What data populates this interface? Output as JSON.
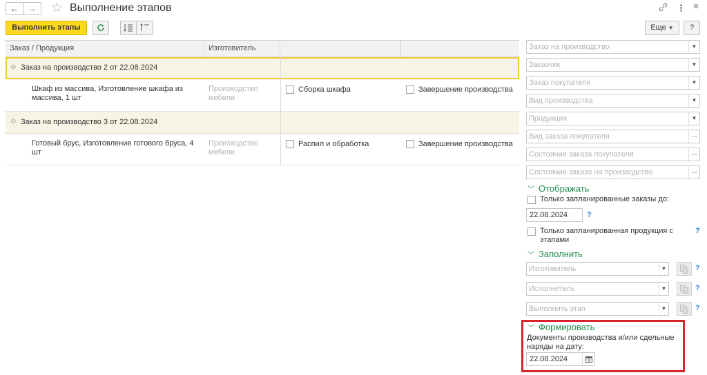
{
  "window": {
    "title": "Выполнение этапов",
    "back_icon": "←",
    "forward_icon": "→",
    "star_icon": "☆",
    "link_icon": "🔗",
    "menu_icon": "⋮",
    "close_icon": "×"
  },
  "toolbar": {
    "run_button": "Выполнить этапы",
    "more_button": "Еще",
    "help_button": "?"
  },
  "table": {
    "columns": [
      "Заказ / Продукция",
      "Изготовитель"
    ],
    "groups": [
      {
        "title": "Заказ на производство 2 от 22.08.2024",
        "product": "Шкаф из массива, Изготовление шкафа из массива, 1 шт",
        "maker": "Производство мебели",
        "stage1": "Сборка шкафа",
        "stage2": "Завершение производства"
      },
      {
        "title": "Заказ на производство 3 от 22.08.2024",
        "product": "Готовый брус, Изготовление готового бруса, 4 шт",
        "maker": "Производство мебели",
        "stage1": "Распил и обработка",
        "stage2": "Завершение производства"
      }
    ]
  },
  "filters": {
    "order": "Заказ на производство",
    "customer": "Заказчик",
    "customer_order": "Заказ покупателя",
    "production_type": "Вид производства",
    "product": "Продукция",
    "customer_order_type": "Вид заказа покупателя",
    "customer_order_state": "Состояние заказа покупателя",
    "production_order_state": "Состояние заказа на производство"
  },
  "display": {
    "title": "Отображать",
    "only_planned_orders": "Только запланированные заказы до:",
    "date": "22.08.2024",
    "only_planned_products": "Только запланированная продукция с этапами",
    "help": "?"
  },
  "fill": {
    "title": "Заполнить",
    "maker": "Изготовитель",
    "executor": "Исполнитель",
    "stage": "Выполнить этап",
    "help": "?"
  },
  "form": {
    "title": "Формировать",
    "description": "Документы производства и/или сдельные наряды на дату:",
    "date": "22.08.2024"
  },
  "colors": {
    "accent_yellow": "#ffd91e",
    "section_green": "#1e8c4b",
    "highlight_red": "#d9232a",
    "group_bg": "#f8f4e5"
  }
}
